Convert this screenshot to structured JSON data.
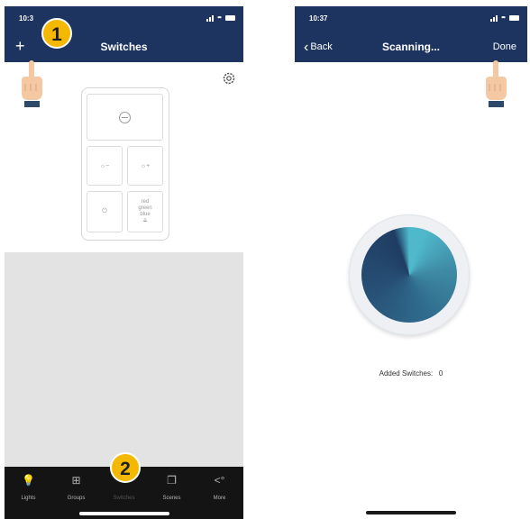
{
  "colors": {
    "navbar": "#1e3460",
    "badge": "#f5b800",
    "tabbar": "#141414",
    "scan_light": "#4fb8cb",
    "scan_dark": "#1f3d63"
  },
  "left": {
    "status_time": "10:3",
    "title": "Switches",
    "add_icon": "plus-icon",
    "settings_icon": "gear-icon",
    "remote": {
      "rgb_lines": [
        "red",
        "green",
        "blue"
      ]
    },
    "tabs": [
      {
        "label": "Lights",
        "icon": "bulb-icon"
      },
      {
        "label": "Groups",
        "icon": "grid-icon"
      },
      {
        "label": "Switches",
        "icon": "switch-icon"
      },
      {
        "label": "Scenes",
        "icon": "scenes-icon"
      },
      {
        "label": "More",
        "icon": "share-icon"
      }
    ],
    "badges": [
      "2",
      "1"
    ]
  },
  "right": {
    "status_time": "10:37",
    "back_label": "Back",
    "title": "Scanning...",
    "done_label": "Done",
    "added_label": "Added Switches:",
    "added_count": "0"
  }
}
